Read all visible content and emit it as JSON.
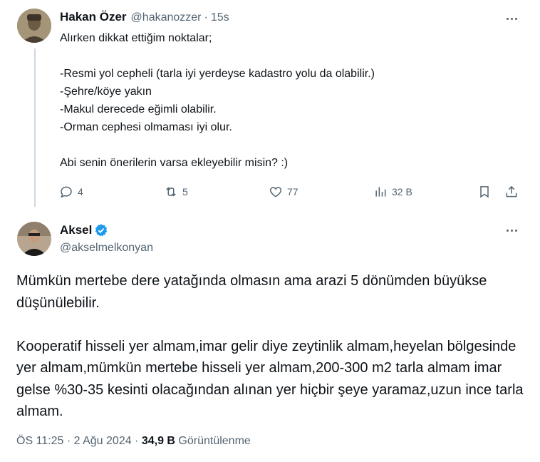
{
  "reply_tweet": {
    "author_name": "Hakan Özer",
    "handle": "@hakanozzer",
    "separator": "·",
    "time": "15s",
    "text": "Alırken dikkat ettiğim noktalar;\n\n-Resmi yol cepheli (tarla iyi yerdeyse kadastro yolu da olabilir.)\n-Şehre/köye yakın\n-Makul derecede eğimli olabilir.\n-Orman cephesi olmaması iyi olur.\n\nAbi senin önerilerin varsa ekleyebilir misin? :)",
    "actions": {
      "replies": "4",
      "retweets": "5",
      "likes": "77",
      "views": "32 B"
    },
    "icons": [
      "reply-icon",
      "retweet-icon",
      "like-icon",
      "views-icon",
      "bookmark-icon",
      "share-icon"
    ]
  },
  "main_tweet": {
    "author_name": "Aksel",
    "verified": true,
    "verified_color": "#1d9bf0",
    "handle": "@akselmelkonyan",
    "text": "Mümkün mertebe dere yatağında olmasın ama arazi 5 dönümden büyükse düşünülebilir.\n\nKooperatif hisseli yer almam,imar gelir diye zeytinlik almam,heyelan bölgesinde yer almam,mümkün mertebe hisseli yer almam,200-300 m2 tarla almam imar gelse %30-35 kesinti olacağından alınan yer hiçbir şeye yaramaz,uzun ince tarla almam.",
    "time": "ÖS 11:25",
    "separator1": " · ",
    "date": "2 Ağu 2024",
    "separator2": " · ",
    "views_count": "34,9 B",
    "views_label": " Görüntülenme"
  },
  "colors": {
    "text": "#0f1419",
    "muted": "#536471",
    "thread_line": "#cfd9de"
  }
}
